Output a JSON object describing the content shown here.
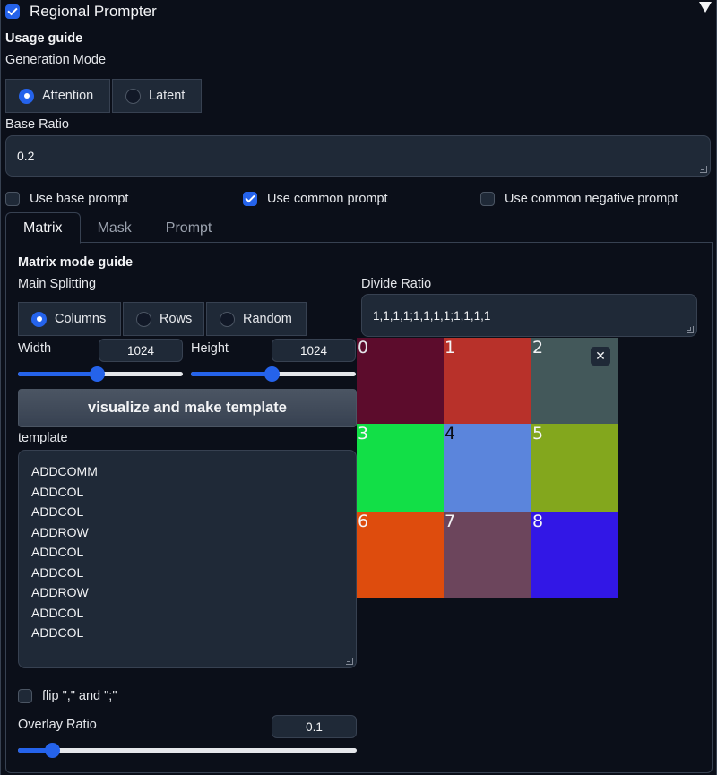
{
  "header": {
    "title": "Regional Prompter",
    "enabled": true
  },
  "usage_guide": "Usage guide",
  "generation_mode": {
    "label": "Generation Mode",
    "options": [
      "Attention",
      "Latent"
    ],
    "selected": "Attention"
  },
  "base_ratio": {
    "label": "Base Ratio",
    "value": "0.2"
  },
  "options": {
    "use_base_prompt": {
      "label": "Use base prompt",
      "checked": false
    },
    "use_common_prompt": {
      "label": "Use common prompt",
      "checked": true
    },
    "use_common_negative_prompt": {
      "label": "Use common negative prompt",
      "checked": false
    }
  },
  "tabs": [
    {
      "label": "Matrix",
      "active": true
    },
    {
      "label": "Mask",
      "active": false
    },
    {
      "label": "Prompt",
      "active": false
    }
  ],
  "matrix": {
    "guide": "Matrix mode guide",
    "main_splitting": {
      "label": "Main Splitting",
      "options": [
        "Columns",
        "Rows",
        "Random"
      ],
      "selected": "Columns"
    },
    "divide_ratio": {
      "label": "Divide Ratio",
      "value": "1,1,1,1;1,1,1,1;1,1,1,1"
    },
    "width": {
      "label": "Width",
      "value": "1024",
      "fraction": 0.48
    },
    "height": {
      "label": "Height",
      "value": "1024",
      "fraction": 0.49
    },
    "visualize_button": "visualize and make template",
    "template": {
      "label": "template",
      "lines": [
        "ADDCOMM",
        "ADDCOL",
        "ADDCOL",
        "ADDROW",
        "ADDCOL",
        "ADDCOL",
        "ADDROW",
        "ADDCOL",
        "ADDCOL"
      ]
    },
    "flip": {
      "label": "flip \",\" and \";\"",
      "checked": false
    },
    "overlay_ratio": {
      "label": "Overlay Ratio",
      "value": "0.1",
      "fraction": 0.1
    },
    "preview_cells": [
      {
        "number": "0",
        "color": "#5c0c2c",
        "text_color": "#e5e7eb"
      },
      {
        "number": "1",
        "color": "#b8312a",
        "text_color": "#f3f4f6"
      },
      {
        "number": "2",
        "color": "#43585a",
        "text_color": "#f3f4f6"
      },
      {
        "number": "3",
        "color": "#12df47",
        "text_color": "#f3f4f6"
      },
      {
        "number": "4",
        "color": "#5b85dc",
        "text_color": "#0b0f19"
      },
      {
        "number": "5",
        "color": "#83a71d",
        "text_color": "#f3f4f6"
      },
      {
        "number": "6",
        "color": "#de4c0d",
        "text_color": "#f3f4f6"
      },
      {
        "number": "7",
        "color": "#6c455c",
        "text_color": "#f3f4f6"
      },
      {
        "number": "8",
        "color": "#3217e6",
        "text_color": "#f3f4f6"
      }
    ],
    "close_icon": "close-icon"
  }
}
